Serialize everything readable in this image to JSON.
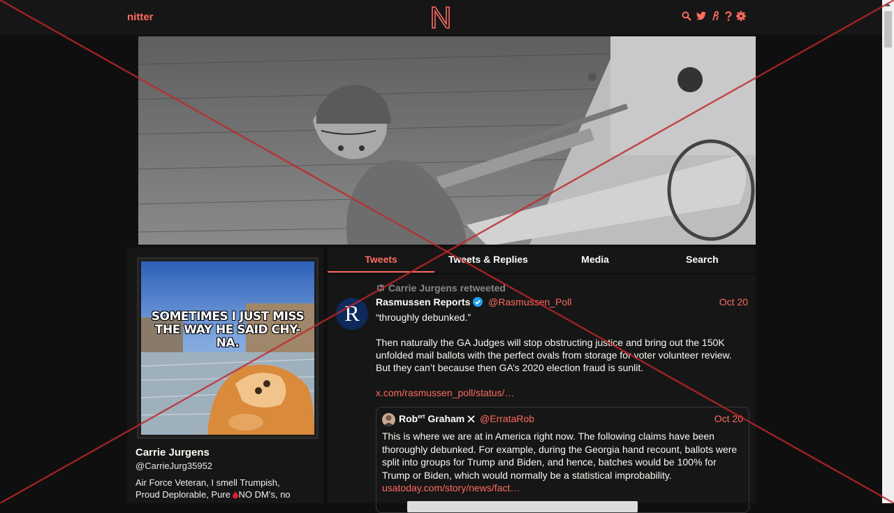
{
  "navbar": {
    "brand": "nitter",
    "icons": [
      "search-icon",
      "twitter-icon",
      "rss-icon",
      "help-icon",
      "settings-icon"
    ]
  },
  "profile": {
    "avatar_caption": "SOMETIMES I JUST MISS THE WAY HE SAID CHY-NA.",
    "name": "Carrie Jurgens",
    "handle": "@CarrieJurg35952",
    "bio_line1": "Air Force Veteran, I smell Trumpish,",
    "bio_line2_a": "Proud Deplorable, Pure",
    "bio_line2_b": "NO DM’s, no"
  },
  "tabs": [
    {
      "label": "Tweets",
      "active": true
    },
    {
      "label": "Tweets & Replies",
      "active": false
    },
    {
      "label": "Media",
      "active": false
    },
    {
      "label": "Search",
      "active": false
    }
  ],
  "tweet": {
    "retweet_label": "Carrie Jurgens retweeted",
    "name": "Rasmussen Reports",
    "handle": "@Rasmussen_Poll",
    "date": "Oct 20",
    "p1": "“throughly debunked.”",
    "p2": "Then naturally the GA Judges will stop obstructing justice and bring out the 150K unfolded mail ballots with the perfect ovals from storage for voter volunteer review. But they can’t because then GA’s 2020 election fraud is sunlit.",
    "link": "x.com/rasmussen_poll/status/…",
    "quote": {
      "name_a": "Rob",
      "name_sup": "ert",
      "name_b": "Graham",
      "handle": "@ErrataRob",
      "date": "Oct 20",
      "body": "This is where we are at in America right now. The following claims have been thoroughly debunked. For example, during the Georgia hand recount, ballots were split into groups for Trump and Biden, and hence, batches would be 100% for Trump or Biden, which would normally be a statistical improbability.",
      "link": "usatoday.com/story/news/fact…"
    }
  },
  "colors": {
    "accent": "#ff6c60",
    "background": "#0f0f0f",
    "panel": "#161616",
    "verified": "#1da1f2",
    "overlay_x": "#c0262b"
  }
}
